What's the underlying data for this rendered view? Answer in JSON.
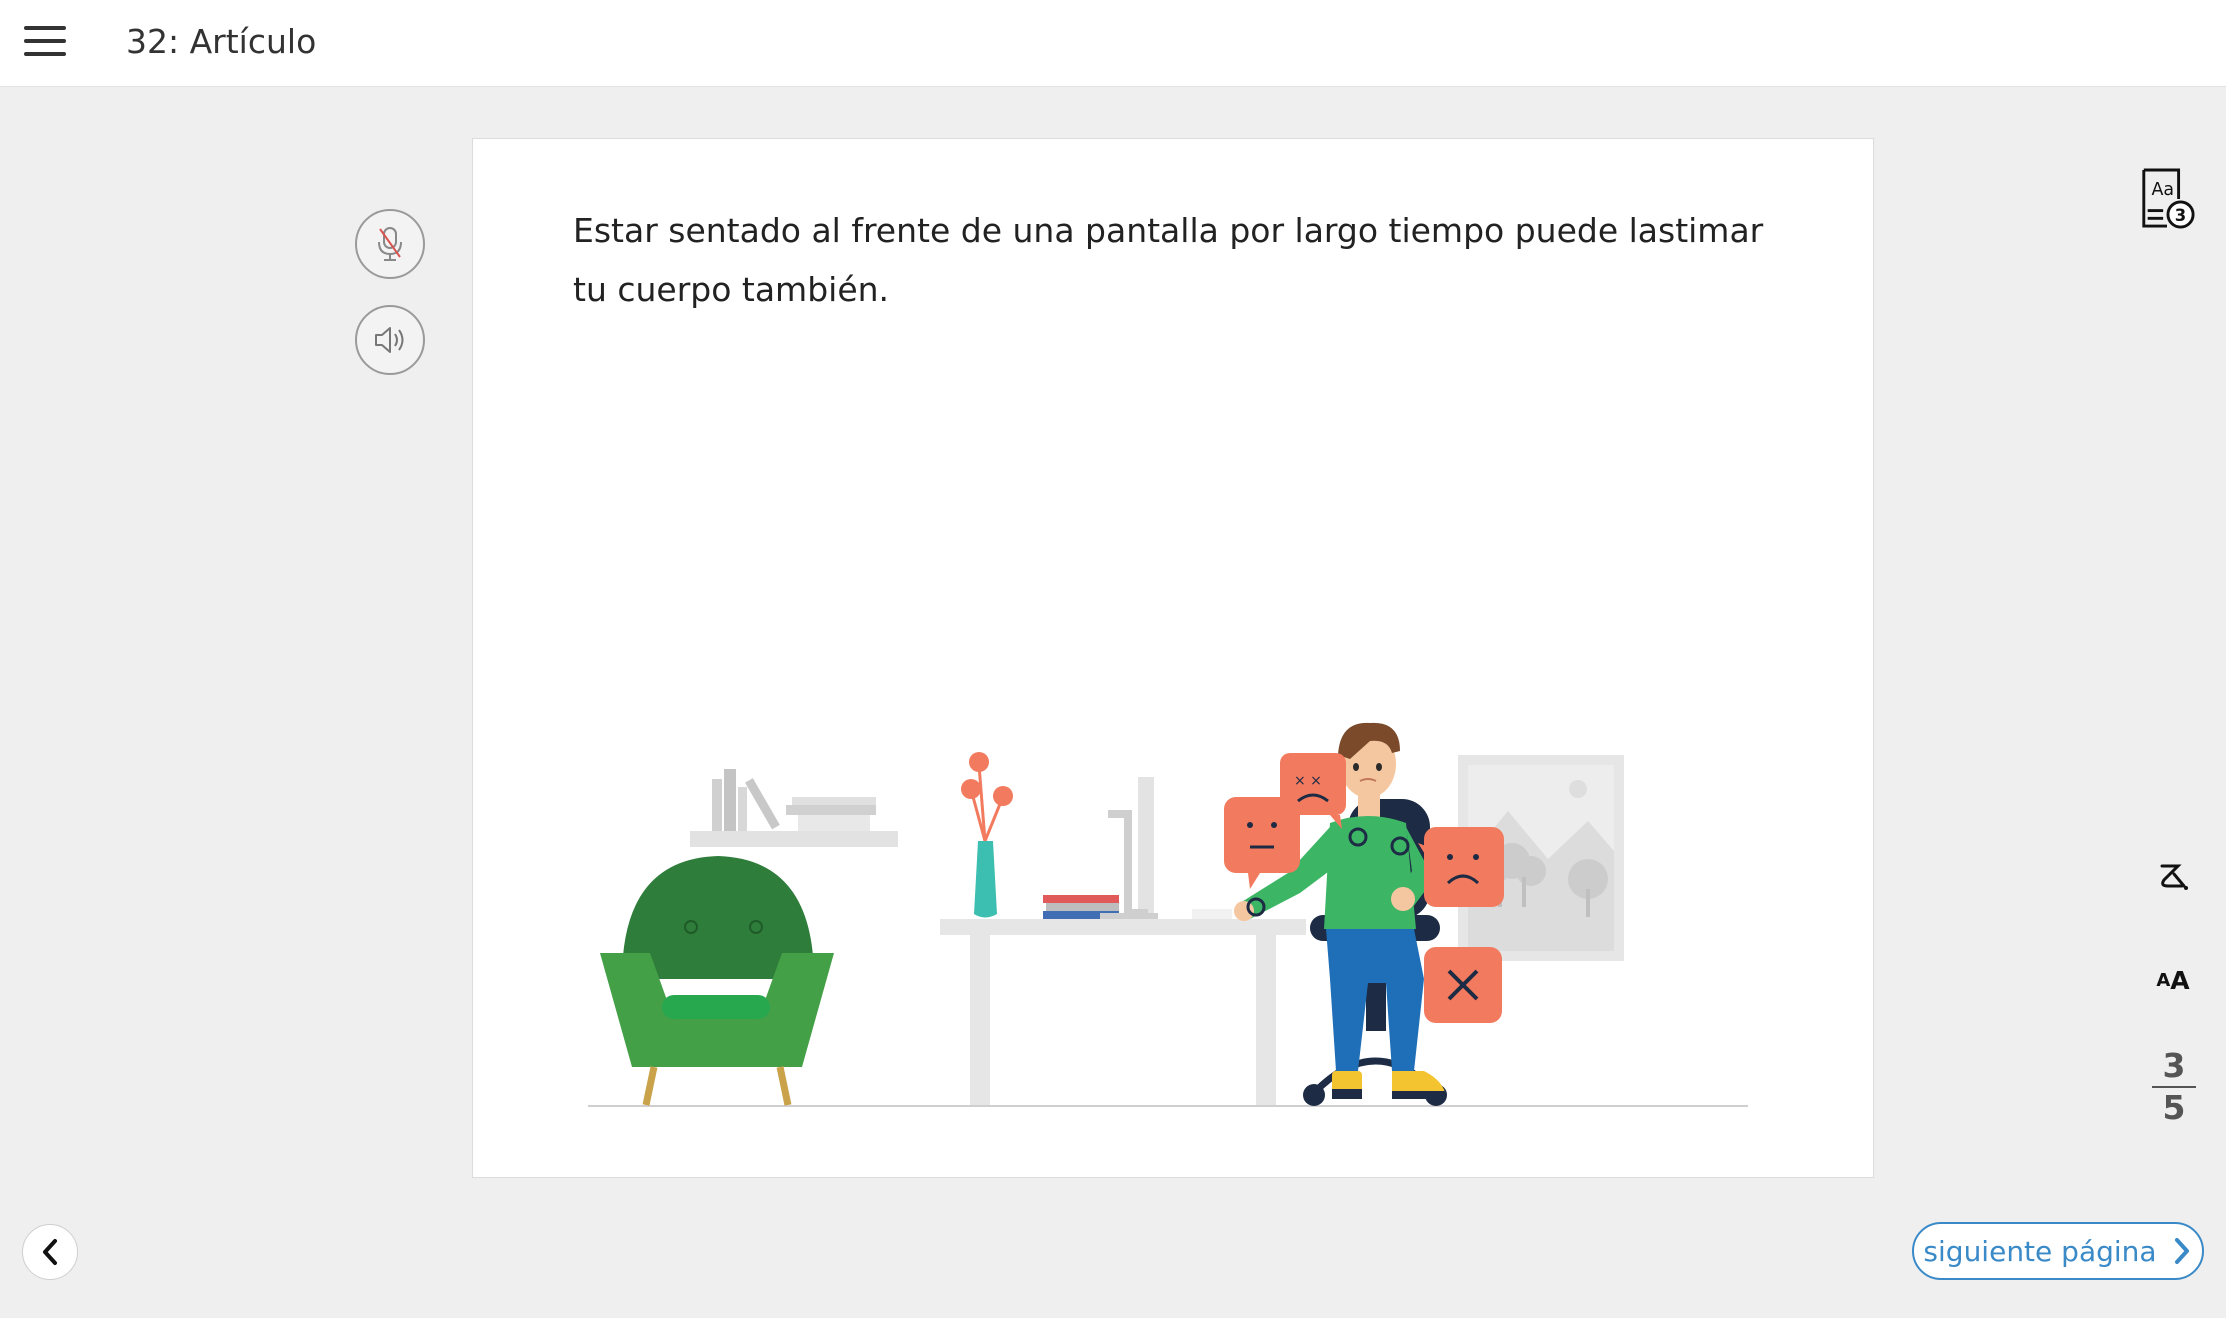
{
  "header": {
    "title": "32: Artículo"
  },
  "article": {
    "text": "Estar sentado al frente de una pantalla por largo tiempo puede lastimar tu cuerpo también."
  },
  "reading_level_badge": {
    "label": "Aa",
    "level": "3"
  },
  "text_size_control": {
    "label_small": "A",
    "label_large": "A"
  },
  "pagination": {
    "current": "3",
    "total": "5"
  },
  "navigation": {
    "next_label": "siguiente página"
  },
  "icons": {
    "menu": "hamburger-icon",
    "microphone": "microphone-muted-icon",
    "speaker": "speaker-icon",
    "reading_level": "reading-level-icon",
    "translate": "translate-icon",
    "back": "chevron-left-icon",
    "next": "chevron-right-icon"
  },
  "colors": {
    "accent": "#3a8ac8",
    "mic_slash": "#d9534f",
    "emotion": "#f27a5e",
    "chair": "#2e7d3a",
    "shirt": "#3cb565",
    "pants": "#1f6fb8"
  }
}
